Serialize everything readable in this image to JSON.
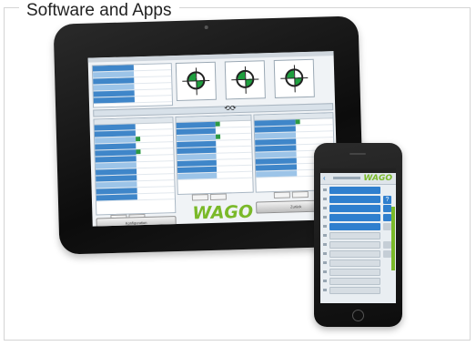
{
  "heading": "Software and Apps",
  "tablet": {
    "brand": "WAGO",
    "left_button": "Konfiguration",
    "right_button": "Zurück"
  },
  "phone": {
    "brand": "WAGO",
    "back_icon": "chevron-left-icon",
    "help_icon": "question-icon"
  },
  "colors": {
    "accent_blue": "#3f86c9",
    "brand_green": "#7ab929",
    "ok_green": "#2e9a44"
  }
}
